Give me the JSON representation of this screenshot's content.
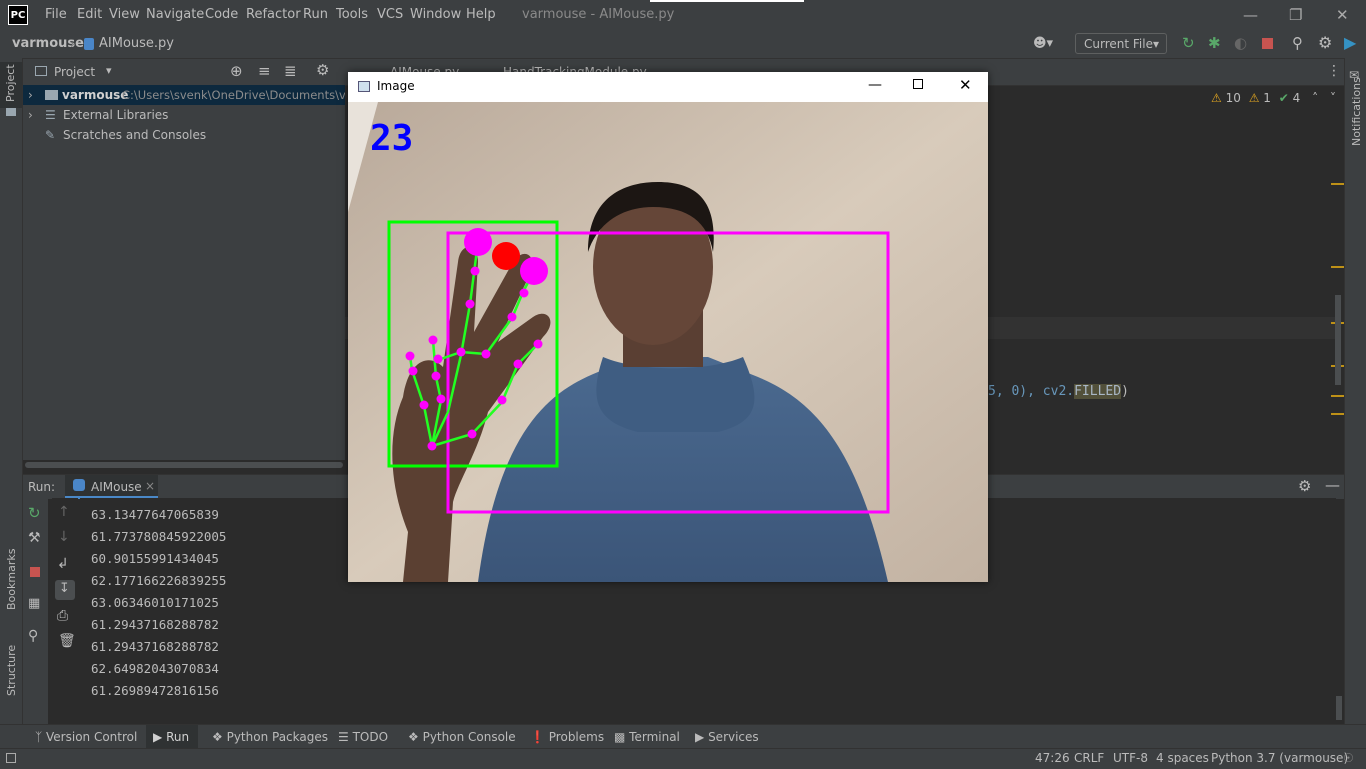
{
  "app": {
    "logo_text": "PC",
    "menu": [
      "File",
      "Edit",
      "View",
      "Navigate",
      "Code",
      "Refactor",
      "Run",
      "Tools",
      "VCS",
      "Window",
      "Help"
    ],
    "window_title": "varmouse - AIMouse.py"
  },
  "navbar": {
    "project": "varmouse",
    "file": "AIMouse.py",
    "run_config": "Current File"
  },
  "project_panel": {
    "title": "Project",
    "tree": [
      {
        "name": "varmouse",
        "path": "C:\\Users\\svenk\\OneDrive\\Documents\\varr"
      },
      {
        "name": "External Libraries"
      },
      {
        "name": "Scratches and Consoles"
      }
    ]
  },
  "editor": {
    "tabs": [
      "AIMouse.py",
      "HandTrackingModule.py"
    ],
    "inspections": {
      "warnings": "10",
      "weak_warnings": "1",
      "ok": "4"
    },
    "code_fragment": "5, 0), cv2.",
    "code_highlight": "FILLED",
    "code_tail": ")"
  },
  "run_panel": {
    "label": "Run:",
    "config": "AIMouse",
    "output": [
      "63.13477647065839",
      "61.773780845922005",
      "60.90155991434045",
      "62.177166226839255",
      "63.06346010171025",
      "61.29437168288782",
      "61.29437168288782",
      "62.64982043070834",
      "61.26989472816156"
    ]
  },
  "left_strip": {
    "project": "Project",
    "bookmarks": "Bookmarks",
    "structure": "Structure"
  },
  "right_strip": {
    "notifications": "Notifications"
  },
  "bottom_tools": [
    "Version Control",
    "Run",
    "Python Packages",
    "TODO",
    "Python Console",
    "Problems",
    "Terminal",
    "Services"
  ],
  "status": {
    "position": "47:26",
    "line_sep": "CRLF",
    "encoding": "UTF-8",
    "indent": "4 spaces",
    "interpreter": "Python 3.7 (varmouse)"
  },
  "image_window": {
    "title": "Image",
    "fps_text": "23"
  },
  "colors": {
    "ide_bg": "#2b2b2b",
    "panel_bg": "#3c3f41",
    "hand_box": "#00ff00",
    "frame_box": "#ff00ff",
    "landmark": "#ff00ff",
    "click_marker": "#ff0000",
    "fps": "#0000ff"
  }
}
